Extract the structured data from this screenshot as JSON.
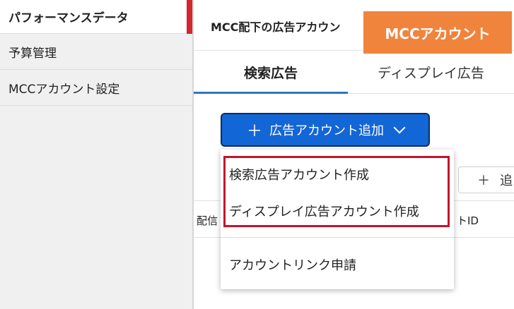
{
  "sidebar": {
    "items": [
      {
        "label": "パフォーマンスデータ"
      },
      {
        "label": "予算管理"
      },
      {
        "label": "MCCアカウント設定"
      }
    ]
  },
  "main": {
    "title": "MCC配下の広告アカウン",
    "badge": "MCCアカウント",
    "tabs": [
      {
        "label": "検索広告"
      },
      {
        "label": "ディスプレイ広告"
      }
    ],
    "add_button": {
      "label": "広告アカウント追加"
    },
    "side_add_label": "追",
    "row_label": "配信",
    "row_id": "トID"
  },
  "dropdown": {
    "items": [
      {
        "label": "検索広告アカウント作成"
      },
      {
        "label": "ディスプレイ広告アカウント作成"
      },
      {
        "label": "アカウントリンク申請"
      }
    ]
  },
  "colors": {
    "accent_red": "#d3262f",
    "badge_orange": "#f0843c",
    "button_blue": "#1366d6",
    "highlight_red": "#c3132e"
  }
}
